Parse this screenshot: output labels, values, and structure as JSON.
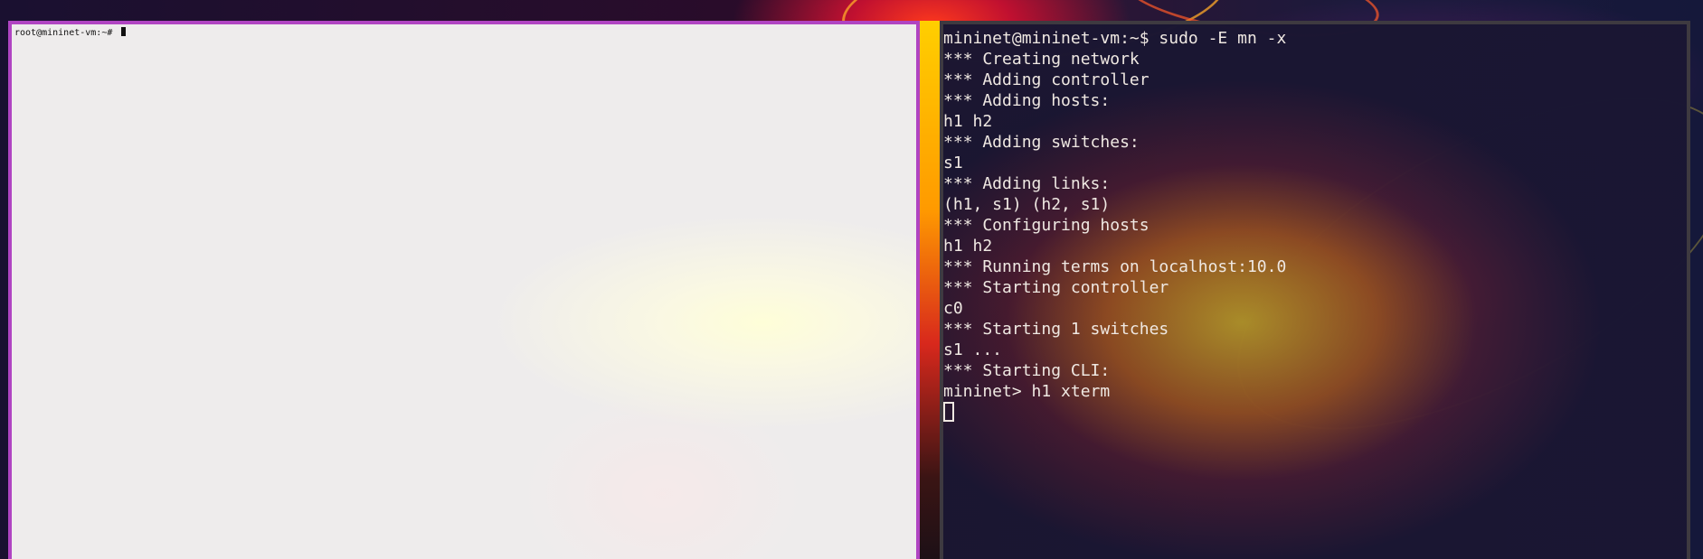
{
  "left_terminal": {
    "prompt": "root@mininet-vm:~# "
  },
  "right_terminal": {
    "lines": [
      "mininet@mininet-vm:~$ sudo -E mn -x",
      "*** Creating network",
      "*** Adding controller",
      "*** Adding hosts:",
      "h1 h2",
      "*** Adding switches:",
      "s1",
      "*** Adding links:",
      "(h1, s1) (h2, s1)",
      "*** Configuring hosts",
      "h1 h2",
      "*** Running terms on localhost:10.0",
      "*** Starting controller",
      "c0",
      "*** Starting 1 switches",
      "s1 ...",
      "*** Starting CLI:",
      "mininet> h1 xterm"
    ]
  },
  "colors": {
    "left_window_border": "#b044c2",
    "right_window_border": "#3e3a40",
    "left_window_bg": "#eeecec",
    "right_window_text": "#efe8e2"
  }
}
